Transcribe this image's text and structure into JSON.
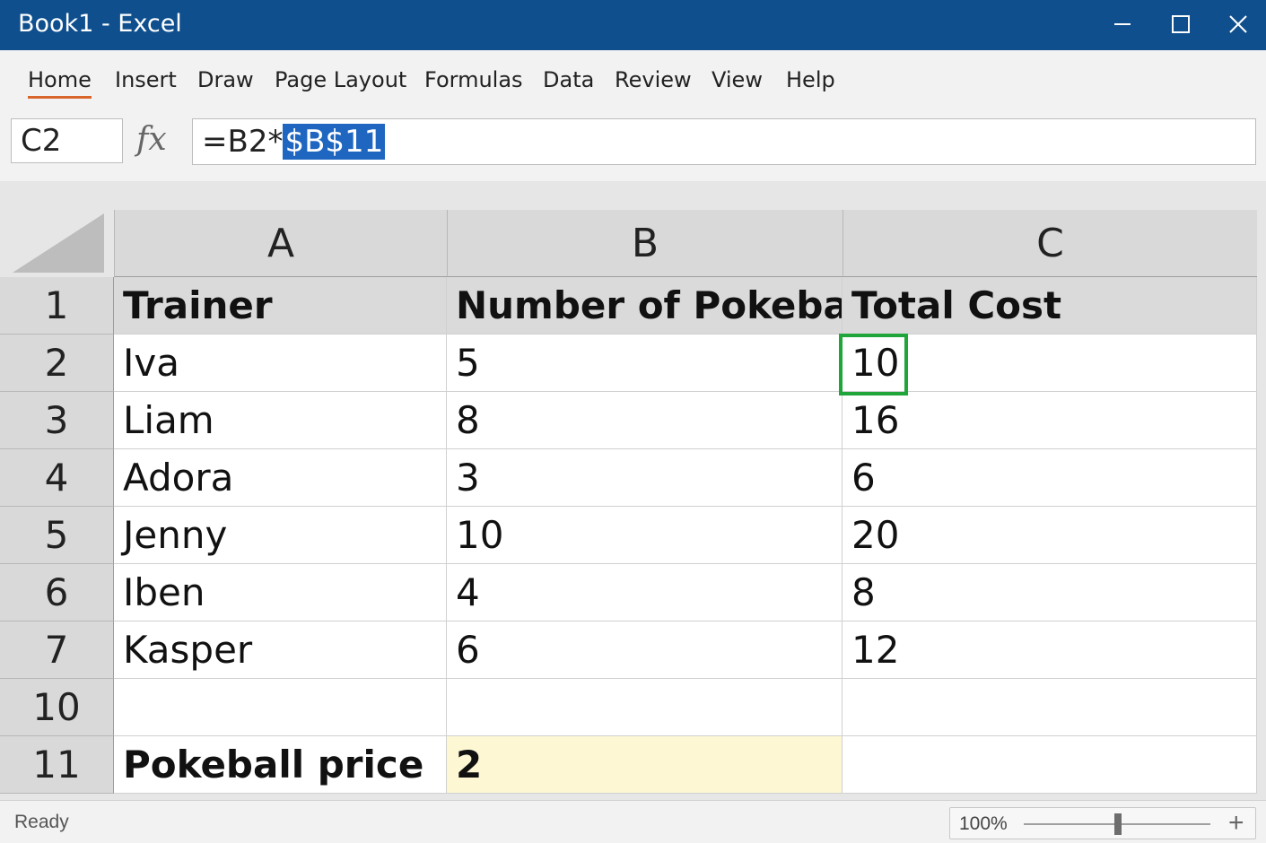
{
  "window": {
    "title": "Book1 - Excel",
    "colors": {
      "titlebar": "#0f4f8e",
      "accent_tab": "#d8652a",
      "selection_border": "#1fa53a",
      "highlight_fill": "#fdf8d3"
    },
    "controls": [
      "minimize-icon",
      "maximize-icon",
      "close-icon"
    ]
  },
  "menu": {
    "tabs": [
      "Home",
      "Insert",
      "Draw",
      "Page Layout",
      "Formulas",
      "Data",
      "Review",
      "View",
      "Help"
    ],
    "active": "Home"
  },
  "formula_bar": {
    "name_box": "C2",
    "fx_label": "fx",
    "formula_prefix": "=B2*",
    "formula_selected": "$B$11"
  },
  "sheet": {
    "columns": [
      "A",
      "B",
      "C"
    ],
    "rows": [
      {
        "label": "1",
        "cells": [
          "Trainer",
          "Number of Pokeballs",
          "Total Cost"
        ]
      },
      {
        "label": "2",
        "cells": [
          "Iva",
          "5",
          "10"
        ]
      },
      {
        "label": "3",
        "cells": [
          "Liam",
          "8",
          "16"
        ]
      },
      {
        "label": "4",
        "cells": [
          "Adora",
          "3",
          "6"
        ]
      },
      {
        "label": "5",
        "cells": [
          "Jenny",
          "10",
          "20"
        ]
      },
      {
        "label": "6",
        "cells": [
          "Iben",
          "4",
          "8"
        ]
      },
      {
        "label": "7",
        "cells": [
          "Kasper",
          "6",
          "12"
        ]
      },
      {
        "label": "10",
        "cells": [
          "",
          "",
          ""
        ]
      },
      {
        "label": "11",
        "cells": [
          "Pokeball price",
          "2",
          ""
        ]
      }
    ],
    "selected_cell": "C2"
  },
  "status_bar": {
    "status": "Ready",
    "zoom": "100%",
    "zoom_in_label": "+"
  }
}
